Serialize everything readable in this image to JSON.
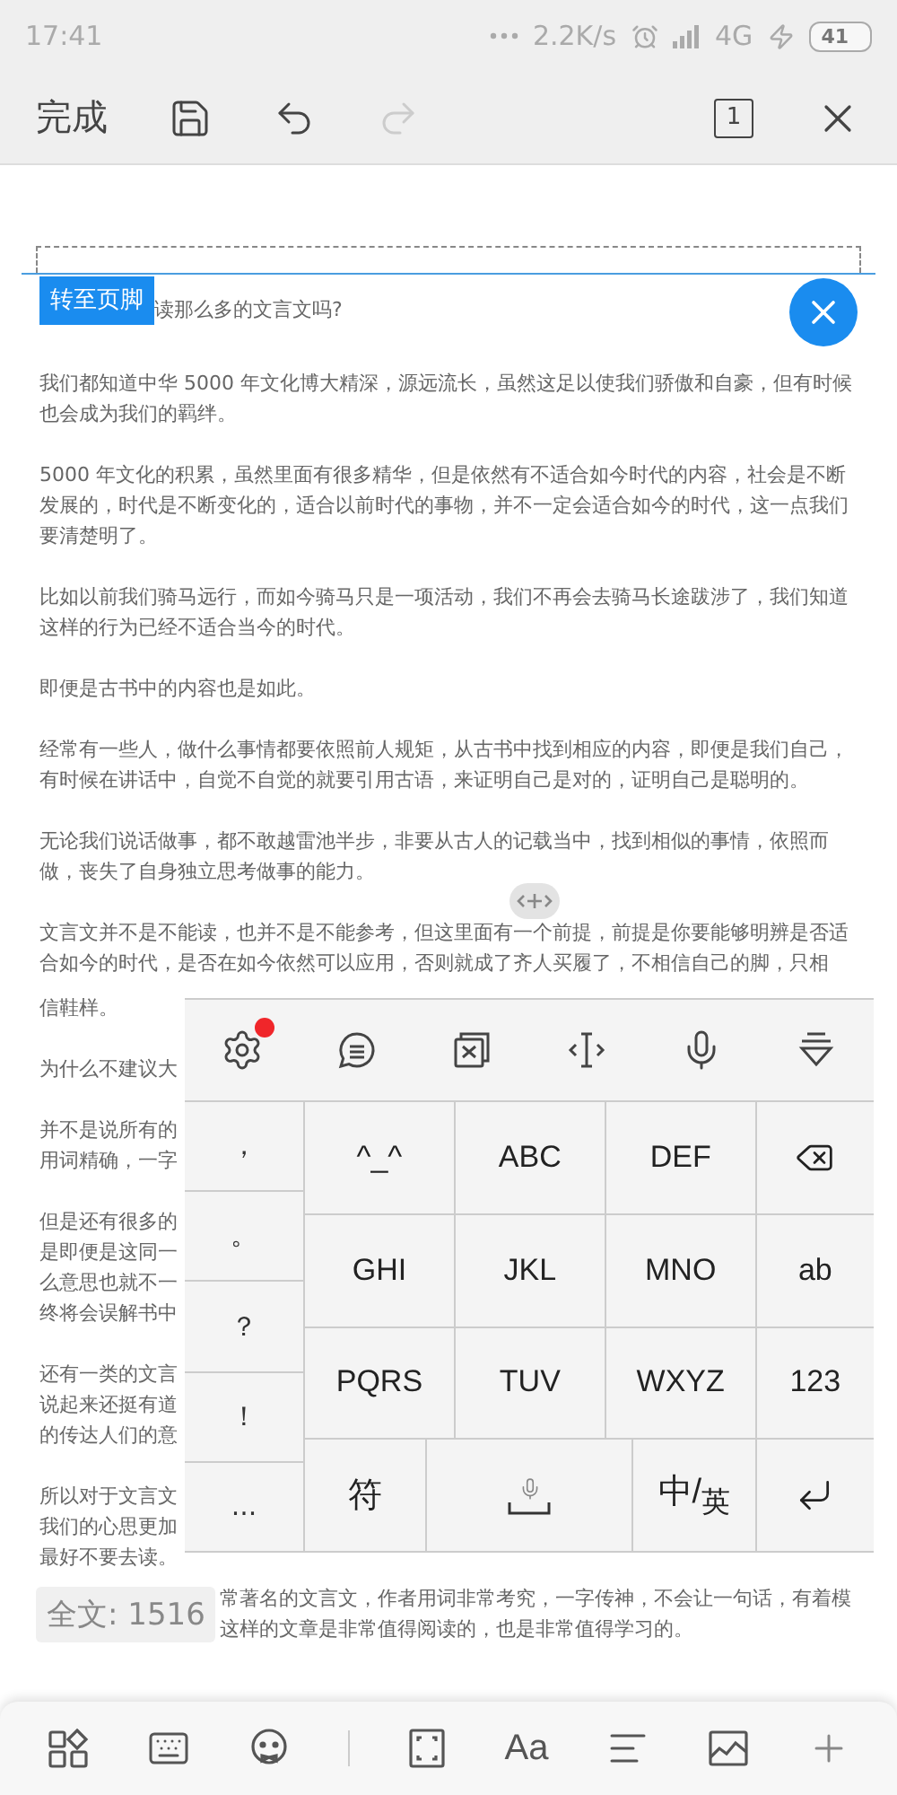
{
  "status_bar": {
    "time": "17:41",
    "speed": "2.2K/s",
    "network": "4G",
    "battery": "41"
  },
  "toolbar": {
    "done": "完成",
    "undo": {
      "disabled": false
    },
    "redo": {
      "disabled": true
    },
    "page_count": "1"
  },
  "footer_bar": {
    "label": "转至页脚",
    "first_line": "读那么多的文言文吗?"
  },
  "document": {
    "paragraphs": [
      "我们都知道中华 5000 年文化博大精深，源远流长，虽然这足以使我们骄傲和自豪，但有时候也会成为我们的羁绊。",
      "5000 年文化的积累，虽然里面有很多精华，但是依然有不适合如今时代的内容，社会是不断发展的，时代是不断变化的，适合以前时代的事物，并不一定会适合如今的时代，这一点我们要清楚明了。",
      "比如以前我们骑马远行，而如今骑马只是一项活动，我们不再会去骑马长途跋涉了，我们知道这样的行为已经不适合当今的时代。",
      "即便是古书中的内容也是如此。",
      "经常有一些人，做什么事情都要依照前人规矩，从古书中找到相应的内容，即便是我们自己，有时候在讲话中，自觉不自觉的就要引用古语，来证明自己是对的，证明自己是聪明的。",
      "无论我们说话做事，都不敢越雷池半步，非要从古人的记载当中，找到相似的事情，依照而做，丧失了自身独立思考做事的能力。",
      "文言文并不是不能读，也并不是不能参考，但这里面有一个前提，前提是你要能够明辨是否适合如今的时代，是否在如今依然可以应用，否则就成了齐人买履了，不相信自己的脚，只相"
    ],
    "side_paragraphs": [
      [
        "信鞋样。"
      ],
      [
        "为什么不建议大"
      ],
      [
        "并不是说所有的",
        "用词精确，一字"
      ],
      [
        "但是还有很多的",
        "是即便是这同一",
        "么意思也就不一",
        "终将会误解书中"
      ],
      [
        "还有一类的文言",
        "说起来还挺有道",
        "的传达人们的意"
      ],
      [
        "所以对于文言文",
        "我们的心思更加",
        "最好不要去读。"
      ]
    ]
  },
  "keyboard": {
    "settings_badge": true,
    "left_keys": [
      "，",
      "。",
      "？",
      "！",
      "..."
    ],
    "rows": [
      [
        {
          "label": "^_^",
          "kind": "char"
        },
        {
          "label": "ABC",
          "kind": "char"
        },
        {
          "label": "DEF",
          "kind": "char"
        },
        {
          "kind": "backspace"
        }
      ],
      [
        {
          "label": "GHI",
          "kind": "char"
        },
        {
          "label": "JKL",
          "kind": "char"
        },
        {
          "label": "MNO",
          "kind": "char"
        },
        {
          "label": "ab",
          "kind": "action"
        }
      ],
      [
        {
          "label": "PQRS",
          "kind": "char"
        },
        {
          "label": "TUV",
          "kind": "char"
        },
        {
          "label": "WXYZ",
          "kind": "char"
        },
        {
          "label": "123",
          "kind": "action"
        }
      ],
      [
        {
          "label": "符",
          "kind": "symbol"
        },
        {
          "kind": "space"
        },
        {
          "label": "中/$_{英}$",
          "kind": "lang"
        },
        {
          "kind": "enter"
        }
      ]
    ]
  },
  "word_count": {
    "label": "全文: 1516",
    "text_lines": [
      "常著名的文言文，作者用词非常考究，一字传神，不会让一句话，有着模",
      "这样的文章是非常值得阅读的，也是非常值得学习的。"
    ]
  },
  "bottom_bar": {
    "font_label": "Aa"
  }
}
